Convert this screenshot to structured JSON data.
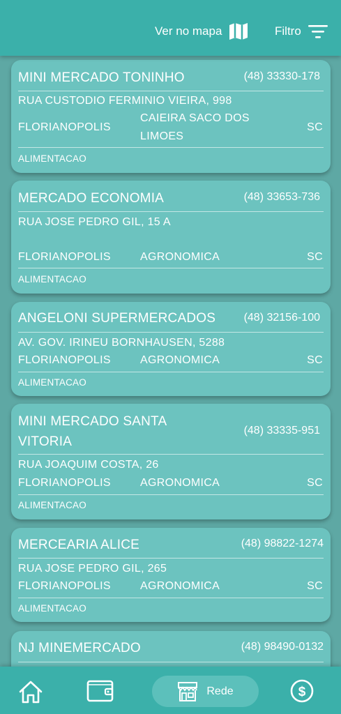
{
  "header": {
    "map_label": "Ver no mapa",
    "filter_label": "Filtro"
  },
  "stores": [
    {
      "name": "MINI MERCADO TONINHO",
      "phone": "(48) 33330-178",
      "address": "RUA CUSTODIO FERMINIO VIEIRA, 998",
      "city": "FLORIANOPOLIS",
      "neighborhood": "CAIEIRA SACO DOS LIMOES",
      "state": "SC",
      "category": "ALIMENTACAO"
    },
    {
      "name": "MERCADO ECONOMIA",
      "phone": "(48) 33653-736",
      "address": "RUA JOSE PEDRO GIL, 15 A",
      "city": "FLORIANOPOLIS",
      "neighborhood": "AGRONOMICA",
      "state": "SC",
      "category": "ALIMENTACAO"
    },
    {
      "name": "ANGELONI SUPERMERCADOS",
      "phone": "(48) 32156-100",
      "address": "AV. GOV. IRINEU BORNHAUSEN, 5288",
      "city": "FLORIANOPOLIS",
      "neighborhood": "AGRONOMICA",
      "state": "SC",
      "category": "ALIMENTACAO"
    },
    {
      "name": "MINI MERCADO SANTA VITORIA",
      "phone": "(48) 33335-951",
      "address": "RUA JOAQUIM COSTA, 26",
      "city": "FLORIANOPOLIS",
      "neighborhood": "AGRONOMICA",
      "state": "SC",
      "category": "ALIMENTACAO"
    },
    {
      "name": "MERCEARIA ALICE",
      "phone": "(48) 98822-1274",
      "address": "RUA JOSE PEDRO GIL, 265",
      "city": "FLORIANOPOLIS",
      "neighborhood": "AGRONOMICA",
      "state": "SC",
      "category": "ALIMENTACAO"
    },
    {
      "name": "NJ MINEMERCADO",
      "phone": "(48) 98490-0132"
    }
  ],
  "nav": {
    "rede_label": "Rede",
    "icons": [
      "home-icon",
      "wallet-icon",
      "store-icon",
      "dollar-icon"
    ]
  },
  "colors": {
    "header": "#3bb0aa",
    "background": "#5ea8a4",
    "card": "#6cc3bf",
    "active_nav": "#5cc0bb"
  }
}
